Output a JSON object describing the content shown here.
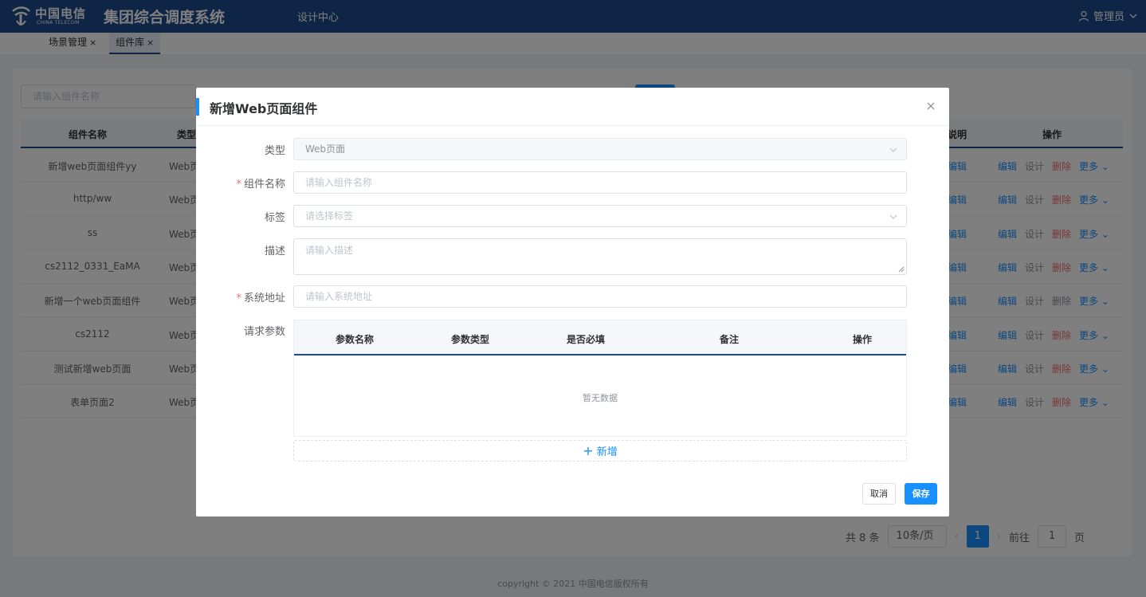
{
  "header": {
    "logo_cn": "中国电信",
    "logo_en": "CHINA TELECOM",
    "system_title": "集团综合调度系统",
    "nav_item": "设计中心",
    "user_name": "管理员"
  },
  "tabs": [
    {
      "label": "场景管理"
    },
    {
      "label": "组件库"
    }
  ],
  "background": {
    "search_placeholder": "请输入组件名称",
    "table_headers": {
      "name": "组件名称",
      "type": "类型",
      "desc": "说明",
      "ops": "操作"
    },
    "rows": [
      {
        "name": "新增web页面组件yy",
        "type": "Web页",
        "edit": "编辑",
        "design": "设计",
        "delete": "删除",
        "more": "更多"
      },
      {
        "name": "http/ww",
        "type": "Web页",
        "edit": "编辑",
        "design": "设计",
        "delete": "删除",
        "more": "更多"
      },
      {
        "name": "ss",
        "type": "Web页",
        "edit": "编辑",
        "design": "设计",
        "delete": "删除",
        "more": "更多"
      },
      {
        "name": "cs2112_0331_EaMA",
        "type": "Web页",
        "edit": "编辑",
        "design": "设计",
        "delete": "删除",
        "more": "更多"
      },
      {
        "name": "新增一个web页面组件",
        "type": "Web页",
        "edit": "编辑",
        "design": "设计",
        "delete": "删除",
        "more": "更多"
      },
      {
        "name": "cs2112",
        "type": "Web页",
        "edit": "编辑",
        "design": "设计",
        "delete": "删除",
        "more": "更多"
      },
      {
        "name": "测试新增web页面",
        "type": "Web页",
        "edit": "编辑",
        "design": "设计",
        "delete": "删除",
        "more": "更多"
      },
      {
        "name": "表单页面2",
        "type": "Web页",
        "edit": "编辑",
        "design": "设计",
        "delete": "删除",
        "more": "更多"
      }
    ],
    "pager": {
      "total": "共 8 条",
      "page_size": "10条/页",
      "current_page": "1",
      "goto_label": "前往",
      "goto_value": "1",
      "page_unit": "页"
    },
    "footer": "copyright © 2021 中国电信版权所有"
  },
  "dialog": {
    "title": "新增Web页面组件",
    "fields": {
      "type": {
        "label": "类型",
        "value": "Web页面"
      },
      "name": {
        "label": "组件名称",
        "placeholder": "请输入组件名称"
      },
      "tags": {
        "label": "标签",
        "placeholder": "请选择标签"
      },
      "desc": {
        "label": "描述",
        "placeholder": "请输入描述"
      },
      "address": {
        "label": "系统地址",
        "placeholder": "请输入系统地址"
      },
      "params": {
        "label": "请求参数"
      }
    },
    "param_table": {
      "headers": [
        "参数名称",
        "参数类型",
        "是否必填",
        "备注",
        "操作"
      ],
      "empty_text": "暂无数据"
    },
    "add_label": "新增",
    "cancel_label": "取消",
    "save_label": "保存"
  },
  "colors": {
    "brand": "#1c4a8c",
    "primary": "#1890ff",
    "danger": "#f56c6c"
  }
}
